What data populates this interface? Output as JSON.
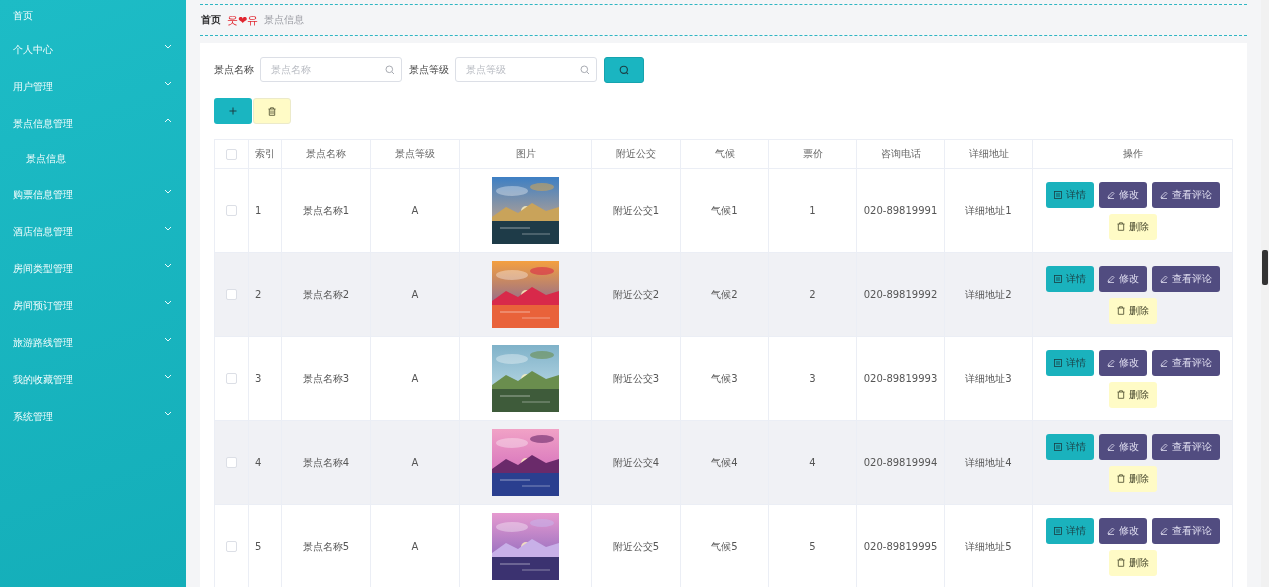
{
  "sidebar": {
    "items": [
      {
        "label": "首页",
        "kind": "link"
      },
      {
        "label": "个人中心",
        "kind": "menu",
        "expanded": false
      },
      {
        "label": "用户管理",
        "kind": "menu",
        "expanded": false
      },
      {
        "label": "景点信息管理",
        "kind": "menu",
        "expanded": true,
        "children": [
          {
            "label": "景点信息"
          }
        ]
      },
      {
        "label": "购票信息管理",
        "kind": "menu",
        "expanded": false
      },
      {
        "label": "酒店信息管理",
        "kind": "menu",
        "expanded": false
      },
      {
        "label": "房间类型管理",
        "kind": "menu",
        "expanded": false
      },
      {
        "label": "房间预订管理",
        "kind": "menu",
        "expanded": false
      },
      {
        "label": "旅游路线管理",
        "kind": "menu",
        "expanded": false
      },
      {
        "label": "我的收藏管理",
        "kind": "menu",
        "expanded": false
      },
      {
        "label": "系统管理",
        "kind": "menu",
        "expanded": false
      }
    ]
  },
  "breadcrumb": {
    "home": "首页",
    "separator": "웃❤유",
    "current": "景点信息"
  },
  "search": {
    "fields": [
      {
        "label": "景点名称",
        "placeholder": "景点名称"
      },
      {
        "label": "景点等级",
        "placeholder": "景点等级"
      }
    ]
  },
  "table": {
    "all_selected": false,
    "columns": [
      "索引",
      "景点名称",
      "景点等级",
      "图片",
      "附近公交",
      "气候",
      "票价",
      "咨询电话",
      "详细地址",
      "操作"
    ],
    "rows": [
      {
        "selected": false,
        "index": "1",
        "name": "景点名称1",
        "level": "A",
        "bus": "附近公交1",
        "climate": "气候1",
        "price": "1",
        "phone": "020-89819991",
        "address": "详细地址1",
        "actions": [
          {
            "kind": "detail",
            "label": "详情"
          },
          {
            "kind": "edit",
            "label": "修改"
          },
          {
            "kind": "comments",
            "label": "查看评论"
          },
          {
            "kind": "delete",
            "label": "删除"
          }
        ]
      },
      {
        "selected": false,
        "index": "2",
        "name": "景点名称2",
        "level": "A",
        "bus": "附近公交2",
        "climate": "气候2",
        "price": "2",
        "phone": "020-89819992",
        "address": "详细地址2",
        "actions": [
          {
            "kind": "detail",
            "label": "详情"
          },
          {
            "kind": "edit",
            "label": "修改"
          },
          {
            "kind": "comments",
            "label": "查看评论"
          },
          {
            "kind": "delete",
            "label": "删除"
          }
        ]
      },
      {
        "selected": false,
        "index": "3",
        "name": "景点名称3",
        "level": "A",
        "bus": "附近公交3",
        "climate": "气候3",
        "price": "3",
        "phone": "020-89819993",
        "address": "详细地址3",
        "actions": [
          {
            "kind": "detail",
            "label": "详情"
          },
          {
            "kind": "edit",
            "label": "修改"
          },
          {
            "kind": "comments",
            "label": "查看评论"
          },
          {
            "kind": "delete",
            "label": "删除"
          }
        ]
      },
      {
        "selected": false,
        "index": "4",
        "name": "景点名称4",
        "level": "A",
        "bus": "附近公交4",
        "climate": "气候4",
        "price": "4",
        "phone": "020-89819994",
        "address": "详细地址4",
        "actions": [
          {
            "kind": "detail",
            "label": "详情"
          },
          {
            "kind": "edit",
            "label": "修改"
          },
          {
            "kind": "comments",
            "label": "查看评论"
          },
          {
            "kind": "delete",
            "label": "删除"
          }
        ]
      },
      {
        "selected": false,
        "index": "5",
        "name": "景点名称5",
        "level": "A",
        "bus": "附近公交5",
        "climate": "气候5",
        "price": "5",
        "phone": "020-89819995",
        "address": "详细地址5",
        "actions": [
          {
            "kind": "detail",
            "label": "详情"
          },
          {
            "kind": "edit",
            "label": "修改"
          },
          {
            "kind": "comments",
            "label": "查看评论"
          },
          {
            "kind": "delete",
            "label": "删除"
          }
        ]
      }
    ]
  }
}
